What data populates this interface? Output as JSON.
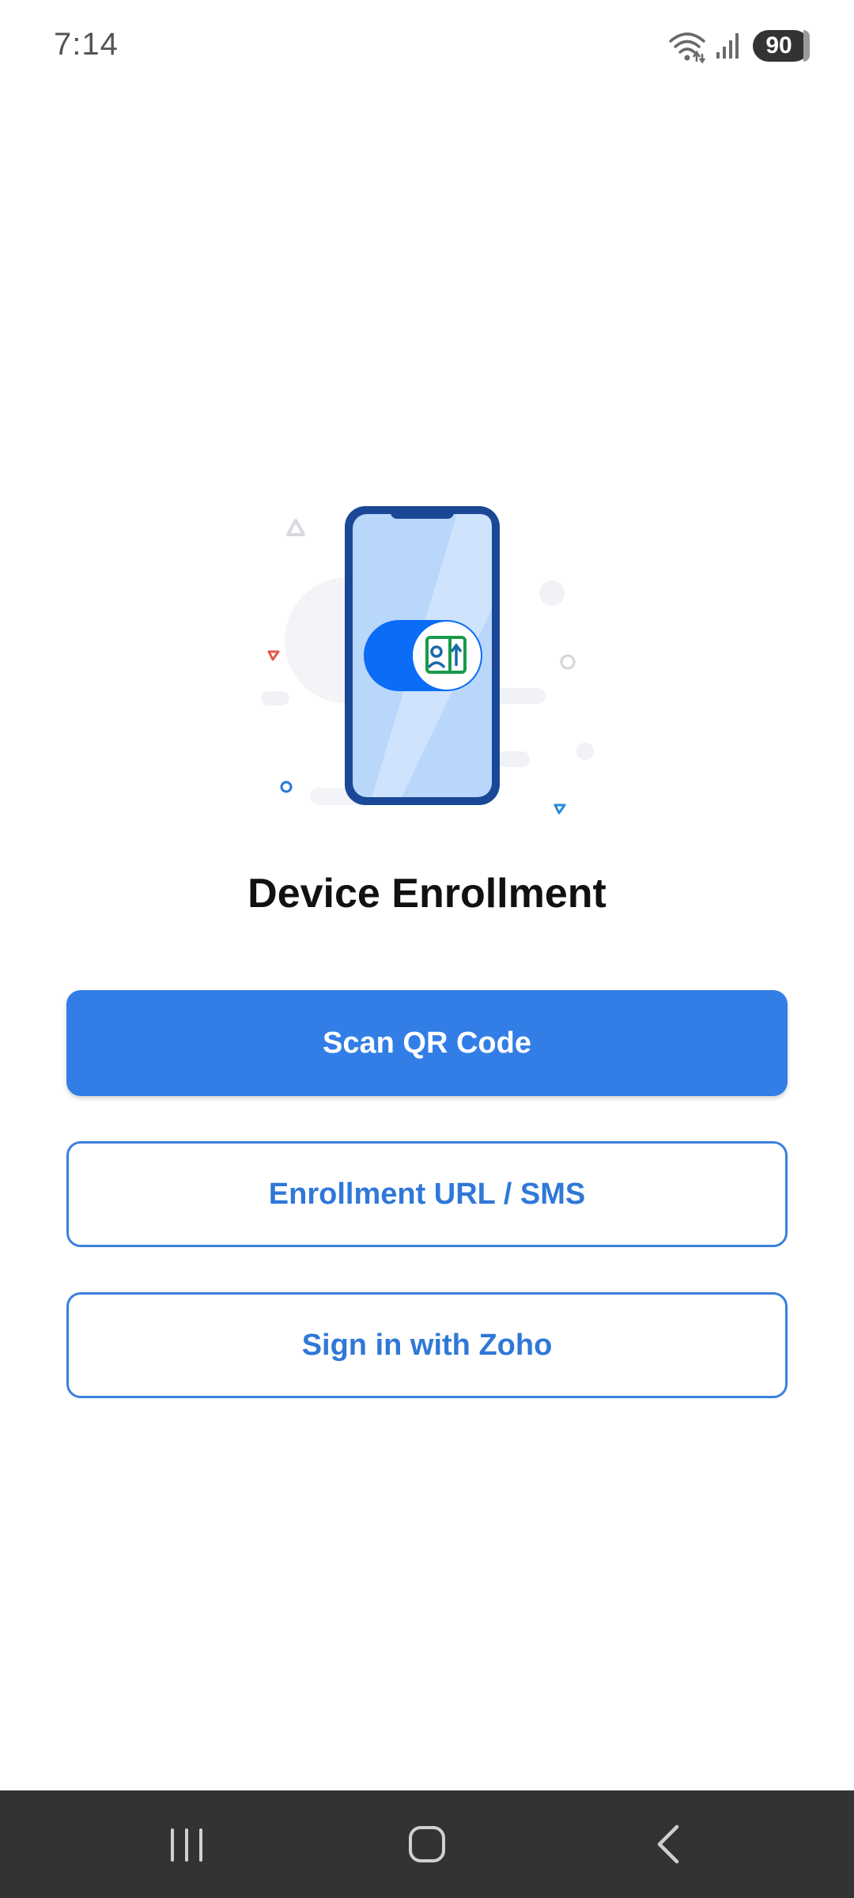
{
  "status_bar": {
    "time": "7:14",
    "battery": "90",
    "icons": [
      "wifi-icon",
      "signal-icon",
      "battery-icon"
    ]
  },
  "illustration": {
    "icon": "phone-enrollment-illustration",
    "colors": {
      "phone_frame": "#1a4896",
      "phone_screen": "#b9d6fb",
      "toggle": "#0a6cf7",
      "badge_green": "#1a9a4a",
      "badge_blue": "#1a6aa8"
    }
  },
  "title": "Device Enrollment",
  "buttons": {
    "scan_qr": "Scan QR Code",
    "enrollment_url": "Enrollment URL / SMS",
    "sign_in_zoho": "Sign in with Zoho"
  },
  "nav_bar": {
    "items": [
      "recents-icon",
      "home-icon",
      "back-icon"
    ]
  },
  "colors": {
    "primary": "#327ee6",
    "outline": "#3a80dd",
    "nav_bg": "#333333"
  }
}
